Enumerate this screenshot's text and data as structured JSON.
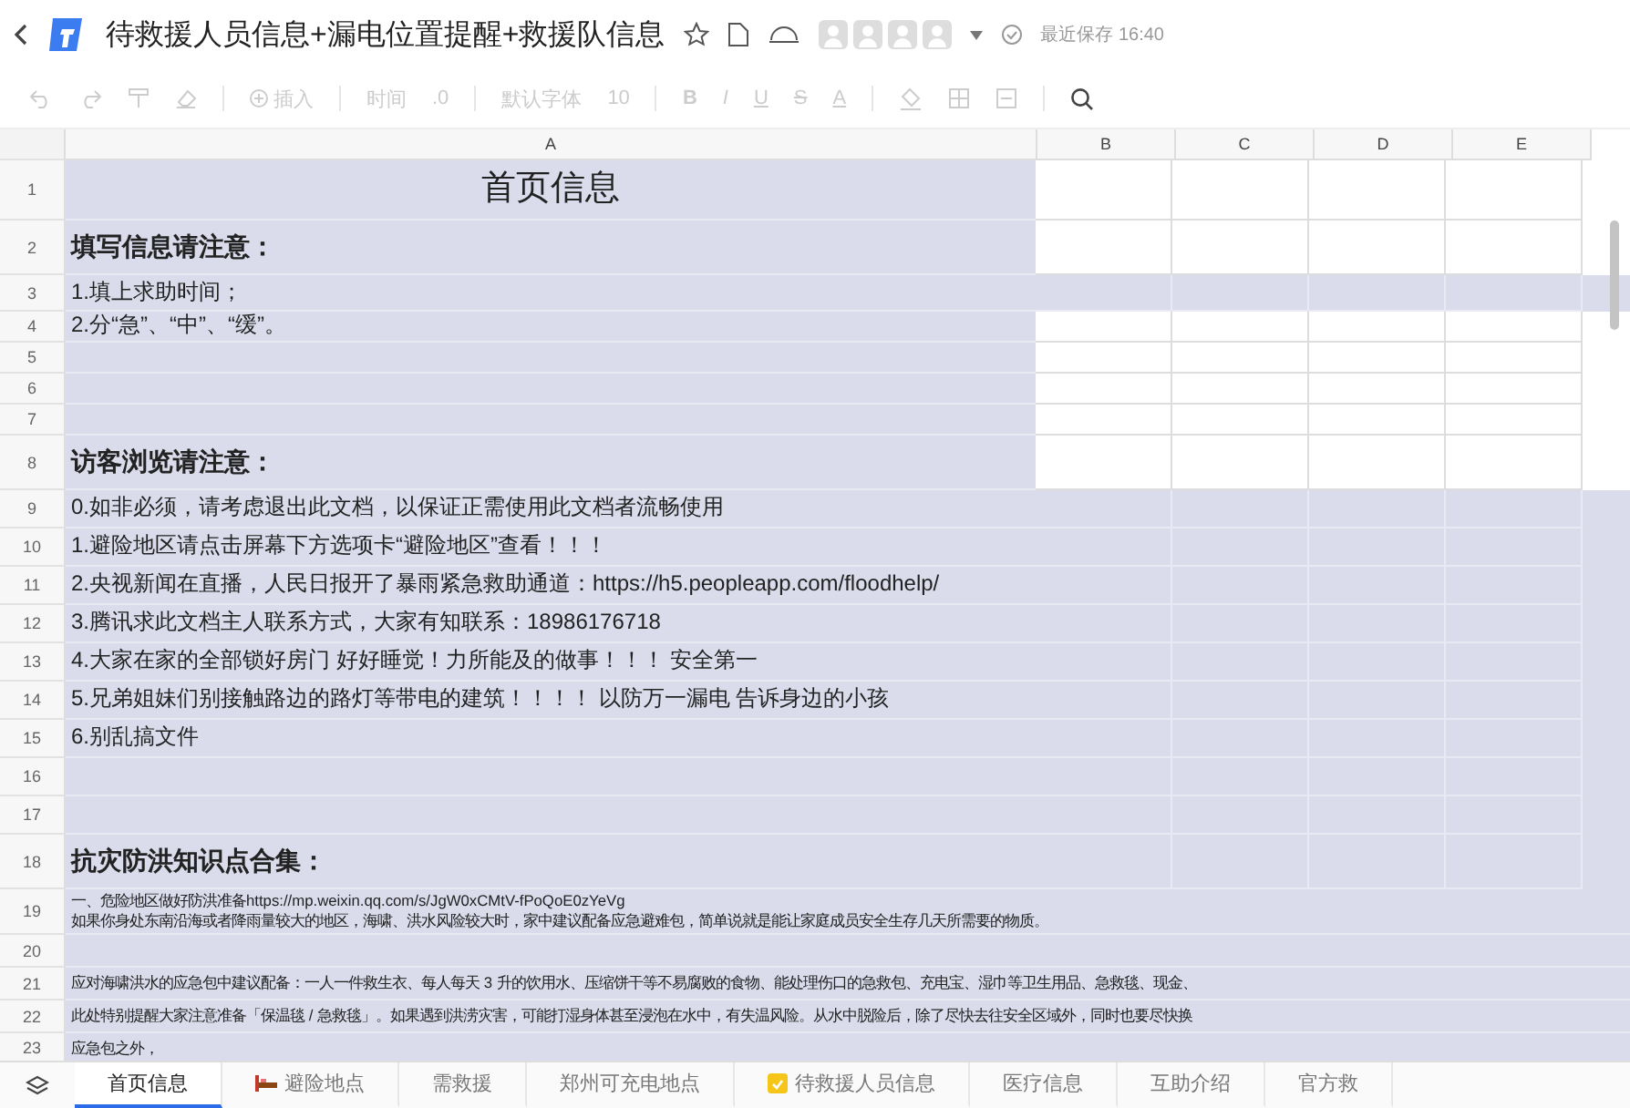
{
  "document": {
    "title": "待救援人员信息+漏电位置提醒+救援队信息",
    "save_status": "最近保存 16:40"
  },
  "toolbar": {
    "insert": "插入",
    "time": "时间",
    "decimal": ".0",
    "font": "默认字体",
    "size": "10",
    "bold": "B",
    "italic": "I",
    "underline": "U",
    "strike": "S",
    "fg_label": "A"
  },
  "columns": [
    "A",
    "B",
    "C",
    "D",
    "E"
  ],
  "rows": [
    {
      "number": "1",
      "kind": "title",
      "text": "首页信息",
      "band": false
    },
    {
      "number": "2",
      "kind": "heading",
      "text": "填写信息请注意：",
      "band": false
    },
    {
      "number": "3",
      "kind": "text",
      "text": "1.填上求助时间；",
      "band": true
    },
    {
      "number": "4",
      "kind": "text",
      "text": "2.分“急”、“中”、“缓”。",
      "band": false
    },
    {
      "number": "5",
      "kind": "text",
      "text": "",
      "band": false
    },
    {
      "number": "6",
      "kind": "text",
      "text": "",
      "band": false
    },
    {
      "number": "7",
      "kind": "text",
      "text": "",
      "band": false
    },
    {
      "number": "8",
      "kind": "heading",
      "text": "访客浏览请注意：",
      "band": false
    },
    {
      "number": "9",
      "kind": "text",
      "text": "0.如非必须，请考虑退出此文档，以保证正需使用此文档者流畅使用",
      "band": true
    },
    {
      "number": "10",
      "kind": "text",
      "text": "1.避险地区请点击屏幕下方选项卡“避险地区”查看！！！",
      "band": true
    },
    {
      "number": "11",
      "kind": "text",
      "text": "2.央视新闻在直播，人民日报开了暴雨紧急救助通道：https://h5.peopleapp.com/floodhelp/",
      "band": true
    },
    {
      "number": "12",
      "kind": "text",
      "text": "3.腾讯求此文档主人联系方式，大家有知联系：18986176718",
      "band": true
    },
    {
      "number": "13",
      "kind": "text",
      "text": "4.大家在家的全部锁好房门 好好睡觉！力所能及的做事！！！ 安全第一",
      "band": true
    },
    {
      "number": "14",
      "kind": "text",
      "text": "5.兄弟姐妹们别接触路边的路灯等带电的建筑！！！！ 以防万一漏电 告诉身边的小孩",
      "band": true
    },
    {
      "number": "15",
      "kind": "text",
      "text": "6.别乱搞文件",
      "band": true
    },
    {
      "number": "16",
      "kind": "text",
      "text": "",
      "band": true
    },
    {
      "number": "17",
      "kind": "text",
      "text": "",
      "band": true
    },
    {
      "number": "18",
      "kind": "heading",
      "text": "抗灾防洪知识点合集：",
      "band": true
    },
    {
      "number": "19",
      "kind": "small",
      "text": "一、危险地区做好防洪准备https://mp.weixin.qq.com/s/JgW0xCMtV-fPoQoE0zYeVg\n如果你身处东南沿海或者降雨量较大的地区，海啸、洪水风险较大时，家中建议配备应急避难包，简单说就是能让家庭成员安全生存几天所需要的物质。"
    },
    {
      "number": "20",
      "kind": "small",
      "text": ""
    },
    {
      "number": "21",
      "kind": "small",
      "text": "应对海啸洪水的应急包中建议配备：一人一件救生衣、每人每天 3 升的饮用水、压缩饼干等不易腐败的食物、能处理伤口的急救包、充电宝、湿巾等卫生用品、急救毯、现金、"
    },
    {
      "number": "22",
      "kind": "small",
      "text": "此处特别提醒大家注意准备「保温毯 / 急救毯」。如果遇到洪涝灾害，可能打湿身体甚至浸泡在水中，有失温风险。从水中脱险后，除了尽快去往安全区域外，同时也要尽快换"
    },
    {
      "number": "23",
      "kind": "small",
      "text": "应急包之外，"
    }
  ],
  "sheets": [
    {
      "label": "首页信息",
      "selected": true
    },
    {
      "label": "避险地点",
      "selected": false,
      "kind": "bed"
    },
    {
      "label": "需救援",
      "selected": false
    },
    {
      "label": "郑州可充电地点",
      "selected": false
    },
    {
      "label": "待救援人员信息",
      "selected": false,
      "kind": "note"
    },
    {
      "label": "医疗信息",
      "selected": false
    },
    {
      "label": "互助介绍",
      "selected": false
    },
    {
      "label": "官方救",
      "selected": false
    }
  ]
}
